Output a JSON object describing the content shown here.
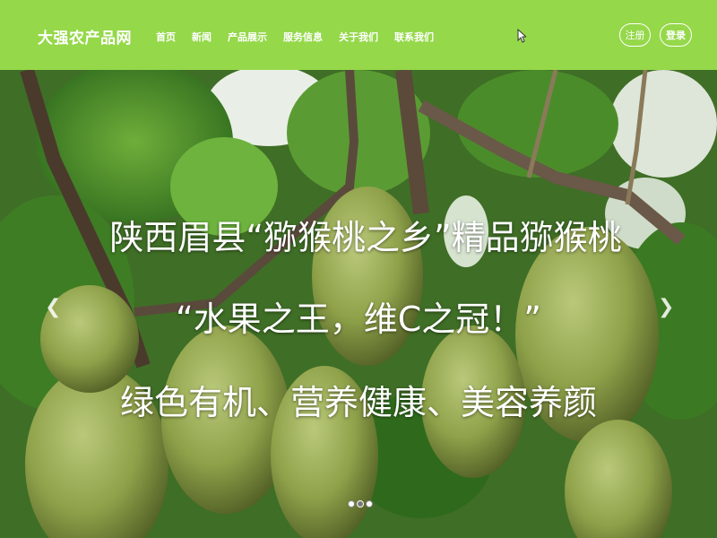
{
  "brand": "大强农产品网",
  "nav": [
    "首页",
    "新闻",
    "产品展示",
    "服务信息",
    "关于我们",
    "联系我们"
  ],
  "auth": {
    "register": "注册",
    "login": "登录"
  },
  "hero": {
    "line1": "陕西眉县“猕猴桃之乡”精品猕猴桃",
    "line2": "“水果之王，维C之冠！”",
    "line3": "绿色有机、营养健康、美容养颜"
  },
  "carousel": {
    "prev_icon": "chevron-left-icon",
    "next_icon": "chevron-right-icon",
    "slide_count": 3,
    "active_index": 1
  },
  "colors": {
    "navbar": "#95d84a",
    "text": "#ffffff"
  }
}
